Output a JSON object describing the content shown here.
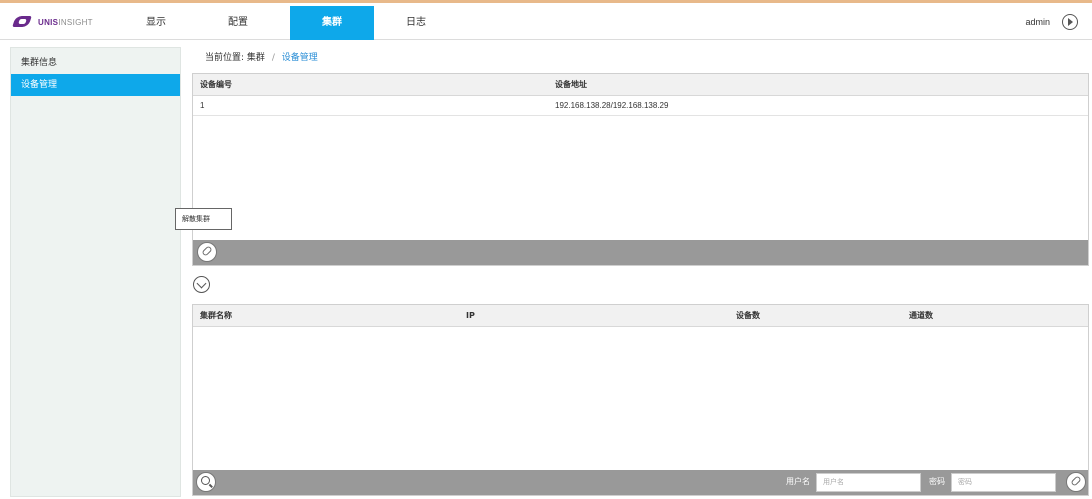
{
  "header": {
    "logo_bold": "UNIS",
    "logo_light": "INSIGHT",
    "nav": [
      "显示",
      "配置",
      "集群",
      "日志"
    ],
    "active_nav": "集群",
    "user": "admin"
  },
  "sidebar": {
    "items": [
      {
        "label": "集群信息",
        "active": false
      },
      {
        "label": "设备管理",
        "active": true
      }
    ]
  },
  "breadcrumb": {
    "prefix": "当前位置:",
    "parent": "集群",
    "separator": "/",
    "current": "设备管理"
  },
  "device_table": {
    "columns": [
      "设备编号",
      "设备地址"
    ],
    "rows": [
      {
        "id": "1",
        "address": "192.168.138.28/192.168.138.29"
      }
    ]
  },
  "tooltip": "解散集群",
  "cluster_table": {
    "columns": [
      "集群名称",
      "IP",
      "设备数",
      "通道数"
    ],
    "rows": []
  },
  "search_bar": {
    "username_label": "用户名",
    "username_placeholder": "用户名",
    "password_label": "密码",
    "password_placeholder": "密码"
  },
  "colors": {
    "accent": "#0ea8ea",
    "logo_purple": "#6a2a8c",
    "toolbar_gray": "#999999",
    "link_blue": "#2a8ed6"
  }
}
